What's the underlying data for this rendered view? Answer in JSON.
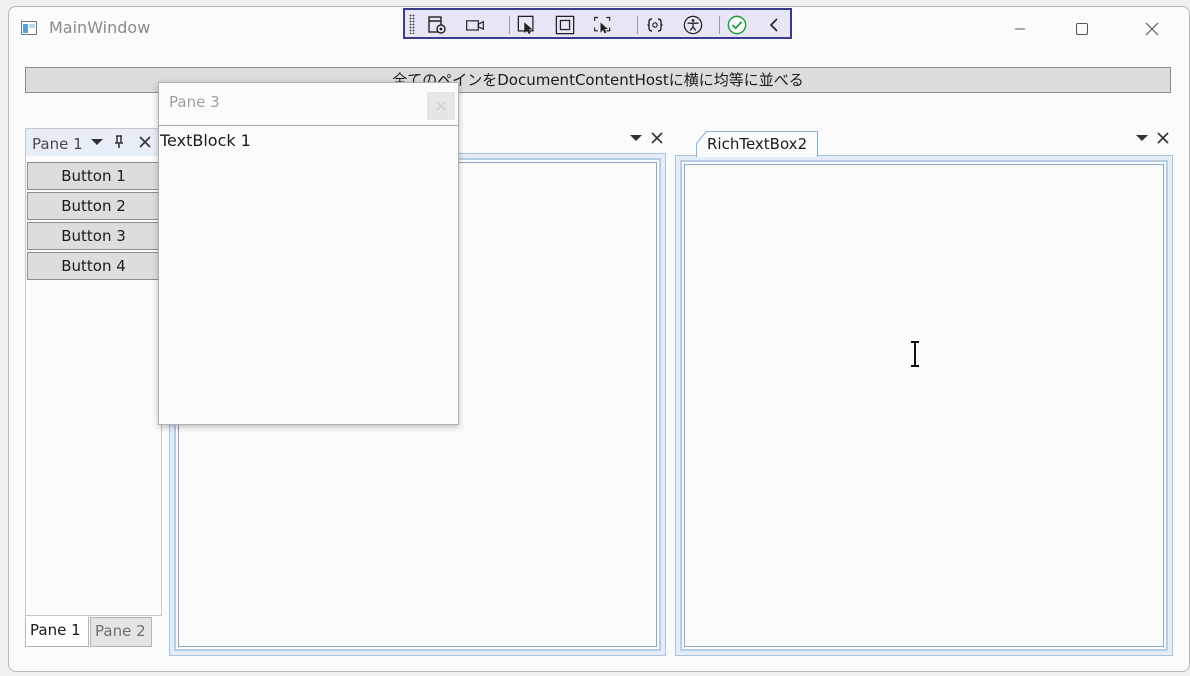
{
  "window": {
    "title": "MainWindow",
    "caption_buttons": [
      "minimize-icon",
      "maximize-icon",
      "close-icon"
    ]
  },
  "devtoolbar": {
    "icons": [
      "live-visual-tree-icon",
      "record-icon",
      "select-element-icon",
      "display-layout-adorners-icon",
      "track-focus-icon",
      "binding-failures-icon",
      "accessibility-icon",
      "check-icon",
      "collapse-chevron-icon"
    ],
    "accent": "#3b3b8e",
    "check_color": "#1e9e3c"
  },
  "arrange_button": {
    "label": "全てのペインをDocumentContentHostに横に均等に並べる"
  },
  "left_pane": {
    "title": "Pane 1",
    "header_icons": [
      "dropdown-icon",
      "pin-icon",
      "close-icon"
    ],
    "buttons": [
      "Button 1",
      "Button 2",
      "Button 3",
      "Button 4"
    ],
    "bottom_tabs": [
      {
        "label": "Pane 1",
        "active": true
      },
      {
        "label": "Pane 2",
        "active": false
      }
    ]
  },
  "floating_pane": {
    "title": "Pane 3",
    "content": "TextBlock 1"
  },
  "document_panes": [
    {
      "tab_label": "",
      "controls": [
        "dropdown-icon",
        "close-icon"
      ]
    },
    {
      "tab_label": "RichTextBox2",
      "controls": [
        "dropdown-icon",
        "close-icon"
      ]
    }
  ],
  "colors": {
    "doc_frame": "#e4edf7",
    "doc_border": "#8aa6c8",
    "button_face": "#dcdcdc"
  }
}
